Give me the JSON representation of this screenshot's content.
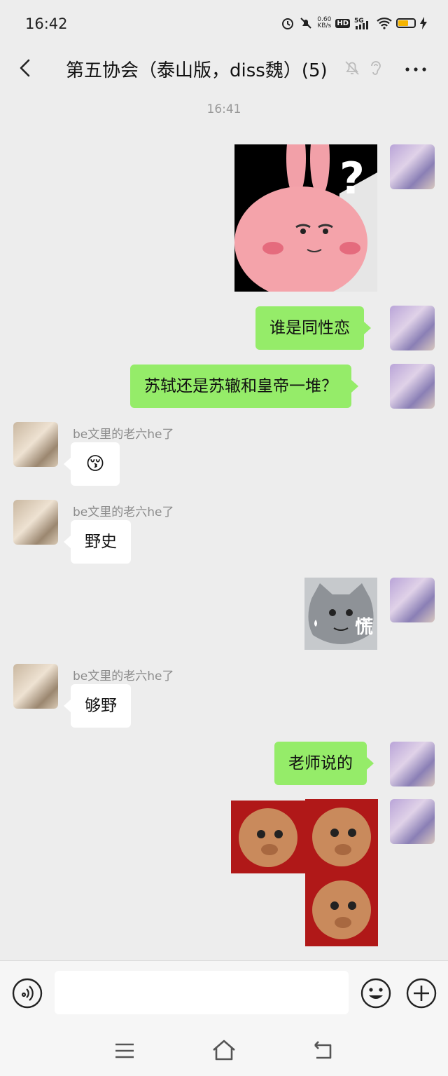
{
  "status_bar": {
    "time": "16:42",
    "net_speed_value": "0.60",
    "net_speed_unit": "KB/s",
    "hd_badge": "HD",
    "network": "5G",
    "battery_level": 0.6
  },
  "header": {
    "title": "第五协会（泰山版，diss魏）(5)",
    "icons": [
      "back-arrow-icon",
      "mute-bell-icon",
      "ear-icon",
      "more-icon"
    ]
  },
  "chat": {
    "timestamp": "16:41",
    "messages": [
      {
        "from": "me",
        "type": "sticker",
        "description": "pink-bunny-question-sticker"
      },
      {
        "from": "me",
        "type": "text",
        "text": "谁是同性恋"
      },
      {
        "from": "me",
        "type": "text",
        "text": "苏轼还是苏辙和皇帝一堆？"
      },
      {
        "from": "other",
        "sender": "be文里的老六he了",
        "type": "emoji",
        "emoji": "😚"
      },
      {
        "from": "other",
        "sender": "be文里的老六he了",
        "type": "text",
        "text": "野史"
      },
      {
        "from": "me",
        "type": "sticker",
        "caption": "慌"
      },
      {
        "from": "other",
        "sender": "be文里的老六he了",
        "type": "text",
        "text": "够野"
      },
      {
        "from": "me",
        "type": "text",
        "text": "老师说的"
      },
      {
        "from": "me",
        "type": "sticker",
        "description": "pig-face-sticker"
      }
    ]
  },
  "input_bar": {
    "placeholder": "",
    "icons": [
      "voice-icon",
      "emoji-icon",
      "plus-icon"
    ]
  },
  "system_nav": {
    "icons": [
      "menu-icon",
      "home-icon",
      "back-icon"
    ]
  },
  "colors": {
    "background": "#ededed",
    "my_bubble": "#95ec69",
    "other_bubble": "#ffffff",
    "sender_name": "#8c8c8c"
  }
}
